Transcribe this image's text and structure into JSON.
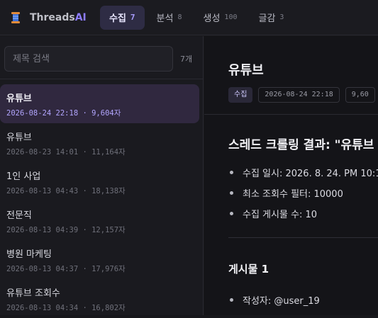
{
  "app": {
    "name_main": "Threads",
    "name_accent": "AI",
    "accent_color": "#8e7dff"
  },
  "tabs": [
    {
      "label": "수집",
      "count": "7",
      "active": true
    },
    {
      "label": "분석",
      "count": "8"
    },
    {
      "label": "생성",
      "count": "100"
    },
    {
      "label": "글감",
      "count": "3"
    }
  ],
  "sidebar": {
    "search_placeholder": "제목 검색",
    "count_label": "7개",
    "items": [
      {
        "title": "유튜브",
        "meta": "2026-08-24 22:18 · 9,604자"
      },
      {
        "title": "유튜브",
        "meta": "2026-08-23 14:01 · 11,164자"
      },
      {
        "title": "1인 사업",
        "meta": "2026-08-13 04:43 · 18,138자"
      },
      {
        "title": "전문직",
        "meta": "2026-08-13 04:39 · 12,157자"
      },
      {
        "title": "병원 마케팅",
        "meta": "2026-08-13 04:37 · 17,976자"
      },
      {
        "title": "유튜브 조회수",
        "meta": "2026-08-13 04:34 · 16,802자"
      }
    ]
  },
  "main": {
    "title": "유튜브",
    "chip_type": "수집",
    "chip_date": "2026-08-24 22:18",
    "chip_chars": "9,60",
    "heading": "스레드 크롤링 결과: \"유튜브",
    "bullets": [
      "수집 일시: 2026. 8. 24. PM 10:1",
      "최소 조회수 필터: 10000",
      "수집 게시물 수: 10"
    ],
    "post_heading": "게시물 1",
    "post_bullets": [
      "작성자: @user_19"
    ]
  }
}
